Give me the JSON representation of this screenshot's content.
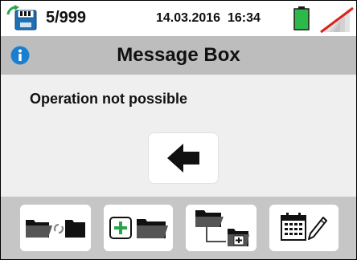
{
  "status_bar": {
    "sd_icon": "sd-card-sync-icon",
    "counter": "5/999",
    "date": "14.03.2016",
    "time": "16:34",
    "battery_icon": "battery-full-icon",
    "wifi_icon": "wifi-disabled-icon"
  },
  "title_bar": {
    "info_icon": "info-icon",
    "title": "Message Box"
  },
  "message": {
    "text": "Operation not possible"
  },
  "back_button": {
    "icon": "arrow-left-icon"
  },
  "softkeys": [
    {
      "name": "folder-transfer-icon"
    },
    {
      "name": "new-folder-icon"
    },
    {
      "name": "folder-tree-icon"
    },
    {
      "name": "calendar-edit-icon"
    }
  ],
  "colors": {
    "titlebar": "#bdbdbd",
    "bottombar": "#c6c6c6",
    "info_blue": "#1b7fd1",
    "battery_green": "#2db84a",
    "plus_green": "#2aa64a",
    "cross_red": "#d9251d"
  }
}
